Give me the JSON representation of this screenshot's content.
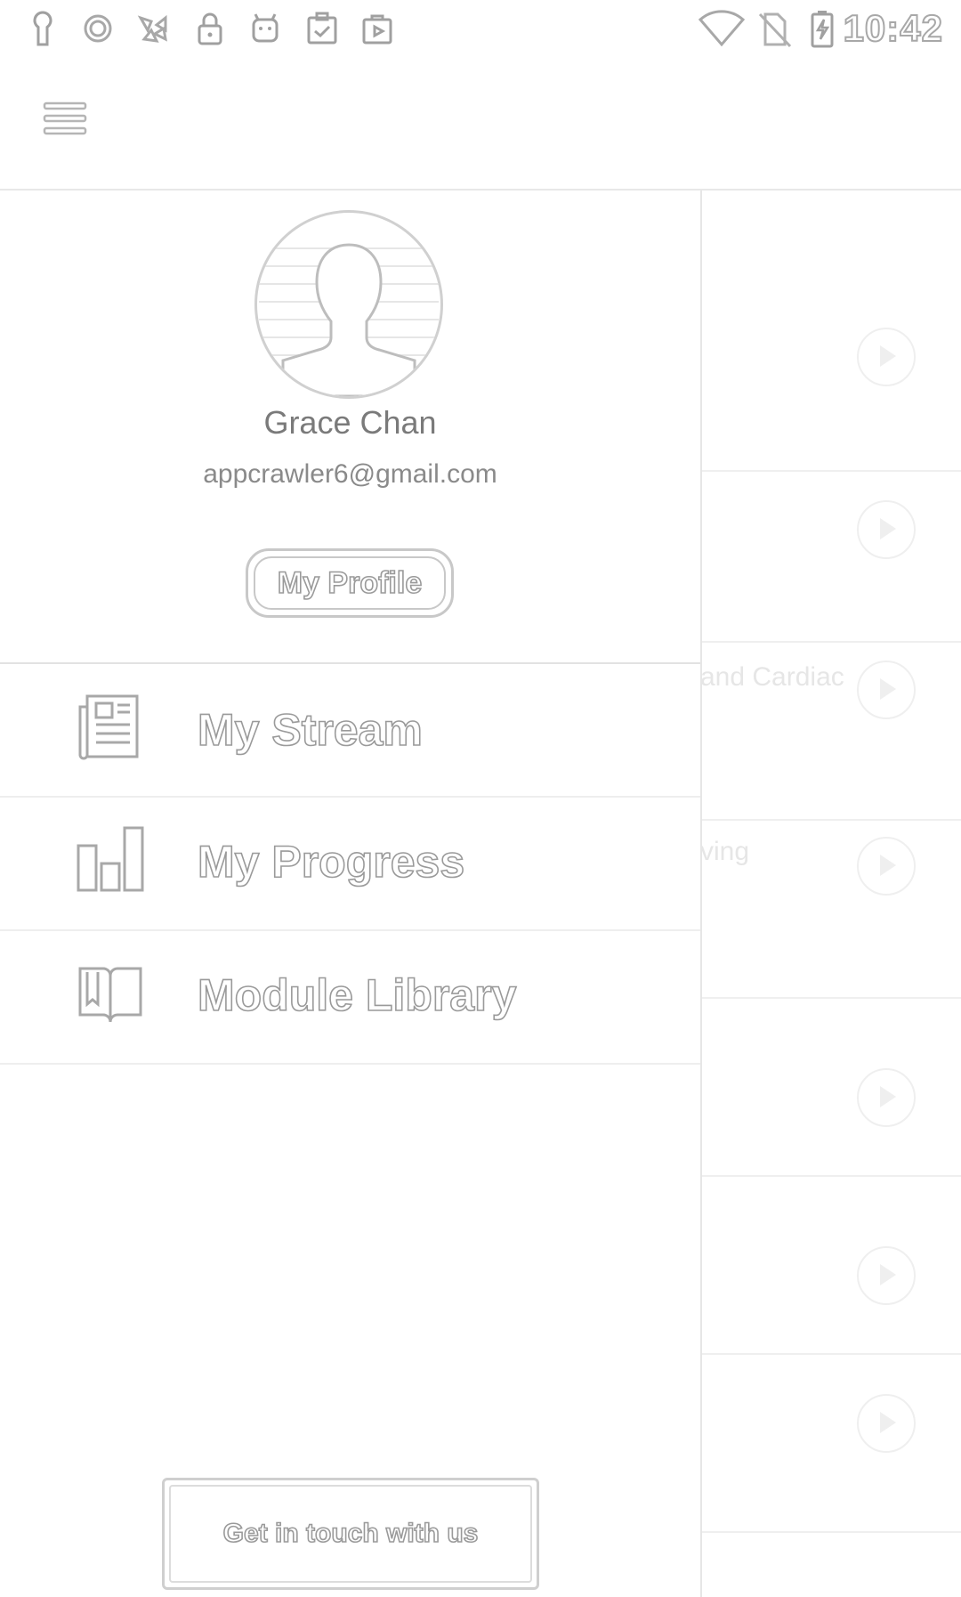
{
  "status_bar": {
    "time": "10:42",
    "left_icons": [
      "keyhole-icon",
      "circle-icon",
      "pinwheel-icon",
      "lock-icon",
      "android-icon",
      "clipboard-check-icon",
      "play-store-icon"
    ],
    "right_icons": [
      "wifi-icon",
      "no-sim-icon",
      "battery-charging-icon"
    ]
  },
  "app_bar": {
    "menu_icon": "hamburger-menu-icon"
  },
  "background": {
    "visible_text": [
      "and Cardiac",
      "ving"
    ]
  },
  "drawer": {
    "profile": {
      "name": "Grace Chan",
      "email": "appcrawler6@gmail.com",
      "button_label": "My Profile"
    },
    "nav_items": [
      {
        "label": "My Stream",
        "icon": "newspaper-icon"
      },
      {
        "label": "My Progress",
        "icon": "bar-chart-icon"
      },
      {
        "label": "Module Library",
        "icon": "open-book-icon"
      }
    ],
    "contact_label": "Get in touch with us"
  }
}
